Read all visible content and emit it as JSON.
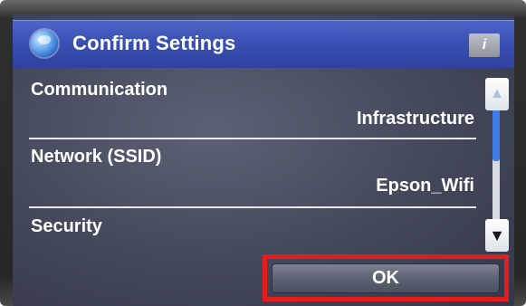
{
  "header": {
    "title": "Confirm Settings",
    "info_icon": "i"
  },
  "settings": [
    {
      "label": "Communication",
      "value": "Infrastructure"
    },
    {
      "label": "Network (SSID)",
      "value": "Epson_Wifi"
    },
    {
      "label": "Security",
      "value": ""
    }
  ],
  "scrollbar": {
    "up_icon": "▲",
    "down_icon": "▼"
  },
  "footer": {
    "ok_label": "OK"
  },
  "icons": {
    "network": "globe-icon",
    "info": "info-icon"
  },
  "colors": {
    "titlebar": "#3a4fb3",
    "screen": "#43475a",
    "highlight": "#e41c1c",
    "scroll_thumb": "#3e7ee6"
  }
}
